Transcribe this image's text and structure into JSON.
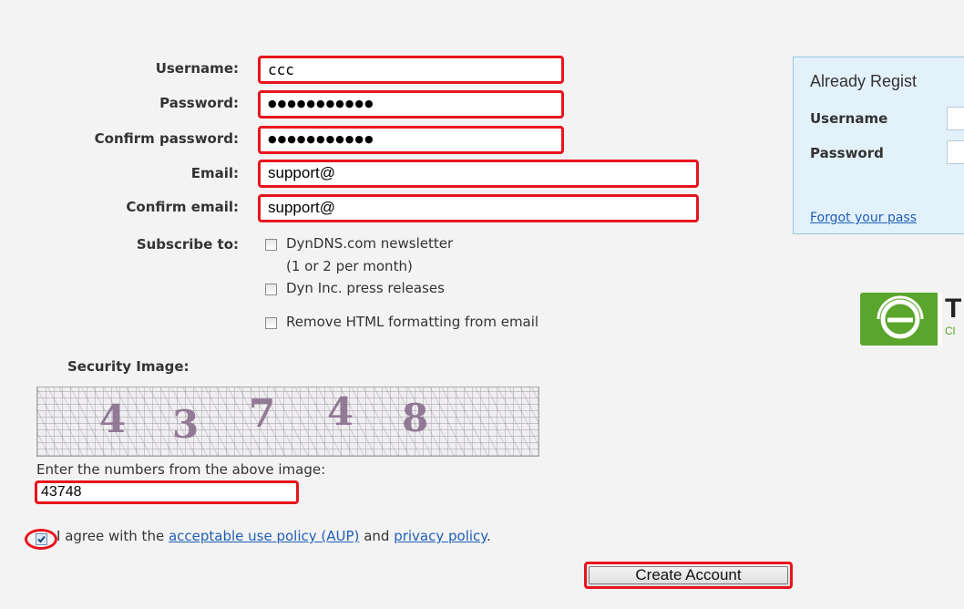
{
  "form": {
    "username_label": "Username:",
    "username_value": "ccc",
    "password_label": "Password:",
    "password_value": "●●●●●●●●●●●",
    "confirm_password_label": "Confirm password:",
    "confirm_password_value": "●●●●●●●●●●●",
    "email_label": "Email:",
    "email_value": "support@",
    "confirm_email_label": "Confirm email:",
    "confirm_email_value": "support@",
    "subscribe_label": "Subscribe to:",
    "subscriptions": [
      {
        "label": "DynDNS.com newsletter",
        "checked": false
      },
      {
        "label": "(1 or 2 per month)"
      },
      {
        "label": "Dyn Inc. press releases",
        "checked": false
      },
      {
        "label": "Remove HTML formatting from email",
        "checked": false
      }
    ]
  },
  "security": {
    "label": "Security Image:",
    "captcha_digits": [
      "4",
      "3",
      "7",
      "4",
      "8"
    ],
    "instruction": "Enter the numbers from the above image:",
    "answer_value": "43748"
  },
  "agreement": {
    "checked": true,
    "prefix": "I agree with the",
    "aup_link": "acceptable use policy (AUP)",
    "middle": "and",
    "privacy_link": "privacy policy",
    "suffix": "."
  },
  "submit_label": "Create Account",
  "sidebar": {
    "title": "Already Regist",
    "username_label": "Username",
    "password_label": "Password",
    "forgot_link": "Forgot your pass"
  },
  "logo": {
    "icon": "e-logo-icon",
    "letter": "T",
    "sub": "Cl",
    "color": "#5aa52c"
  }
}
